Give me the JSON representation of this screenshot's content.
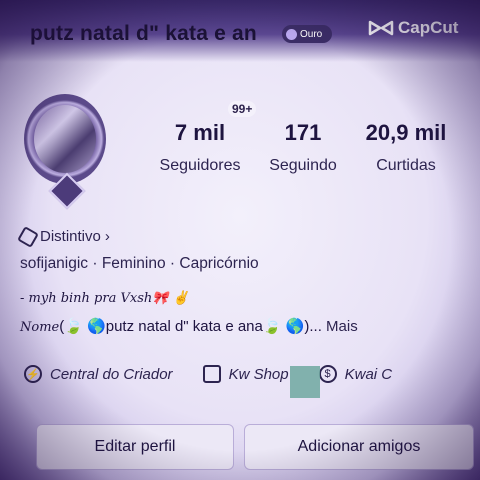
{
  "header": {
    "username": "putz natal d\" kata e an",
    "badge_label": "Ouro",
    "watermark": "CapCut"
  },
  "profile": {
    "notification_count": "99+",
    "stats": [
      {
        "value": "7 mil",
        "label": "Seguidores"
      },
      {
        "value": "171",
        "label": "Seguindo"
      },
      {
        "value": "20,9 mil",
        "label": "Curtidas"
      }
    ],
    "distintivo_label": "Distintivo",
    "handle": "sofijanigic",
    "gender": "Feminino",
    "sign": "Capricórnio",
    "bio_line1": "- myh binh pra Vxsh🎀 ✌",
    "bio_line2_prefix": "Nome",
    "bio_line2_text": "(🍃 🌎putz natal d\" kata e ana🍃 🌎)...",
    "more_label": "Mais"
  },
  "tools": [
    {
      "label": "Central do Criador",
      "icon": "lightning-icon"
    },
    {
      "label": "Kw   Shop",
      "icon": "shopping-bag-icon"
    },
    {
      "label": "Kwai C",
      "icon": "money-bag-icon"
    }
  ],
  "buttons": {
    "edit_profile": "Editar perfil",
    "add_friends": "Adicionar amigos"
  },
  "colors": {
    "text_primary": "#1e1440",
    "top_band": "#3a2a6b",
    "overlay_block": "#6ea8a0"
  }
}
